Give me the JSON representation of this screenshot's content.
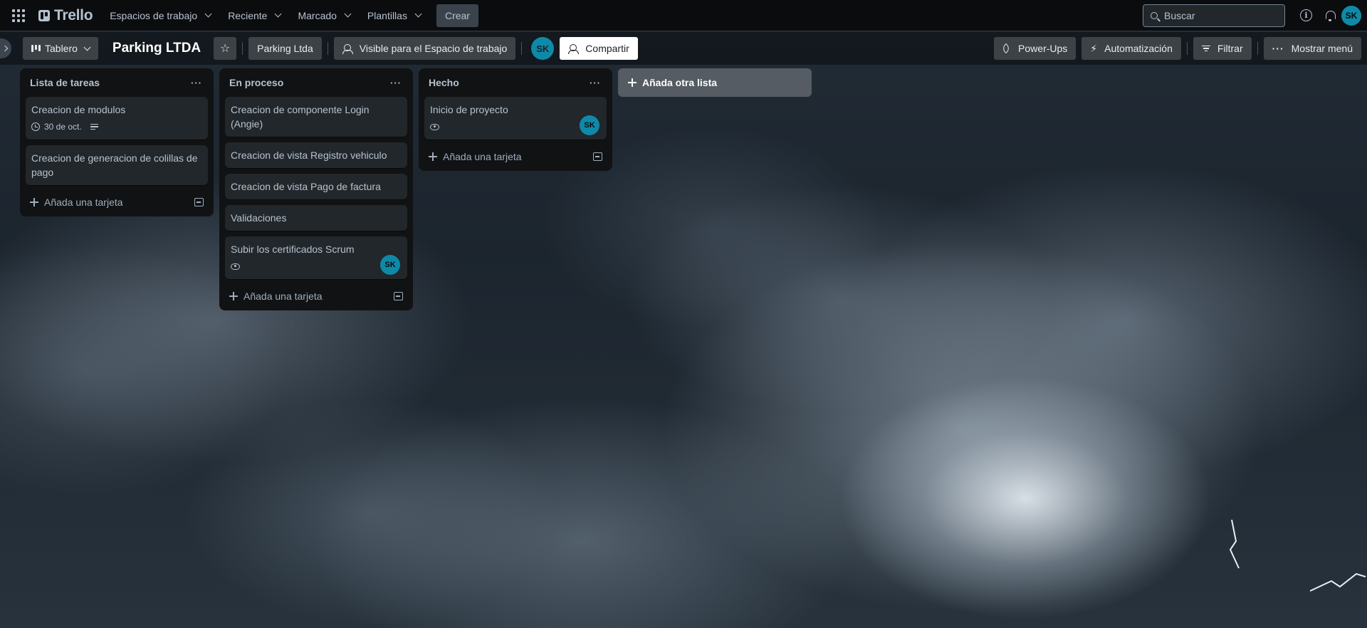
{
  "topnav": {
    "app_name": "Trello",
    "items": [
      {
        "label": "Espacios de trabajo"
      },
      {
        "label": "Reciente"
      },
      {
        "label": "Marcado"
      },
      {
        "label": "Plantillas"
      }
    ],
    "create_label": "Crear",
    "search_placeholder": "Buscar",
    "user_initials": "SK"
  },
  "board_header": {
    "view_label": "Tablero",
    "title": "Parking LTDA",
    "workspace_label": "Parking Ltda",
    "visibility_label": "Visible para el Espacio de trabajo",
    "member_initials": "SK",
    "share_label": "Compartir",
    "powerups_label": "Power-Ups",
    "automation_label": "Automatización",
    "filter_label": "Filtrar",
    "menu_label": "Mostrar menú"
  },
  "lists": [
    {
      "title": "Lista de tareas",
      "cards": [
        {
          "title": "Creacion de modulos",
          "due": "30 de oct."
        },
        {
          "title": "Creacion de generacion de colillas de pago"
        }
      ],
      "add_card_label": "Añada una tarjeta"
    },
    {
      "title": "En proceso",
      "cards": [
        {
          "title": "Creacion de componente Login (Angie)"
        },
        {
          "title": "Creacion de vista Registro vehiculo"
        },
        {
          "title": "Creacion de vista Pago de factura"
        },
        {
          "title": "Validaciones"
        },
        {
          "title": "Subir los certificados Scrum",
          "member": "SK"
        }
      ],
      "add_card_label": "Añada una tarjeta"
    },
    {
      "title": "Hecho",
      "cards": [
        {
          "title": "Inicio de proyecto",
          "member": "SK"
        }
      ],
      "add_card_label": "Añada una tarjeta"
    }
  ],
  "add_list_label": "Añada otra lista",
  "colors": {
    "nav_bg": "#0b0c0e",
    "list_bg": "#101214",
    "card_bg": "#22272b",
    "avatar": "#0e8aa8"
  }
}
